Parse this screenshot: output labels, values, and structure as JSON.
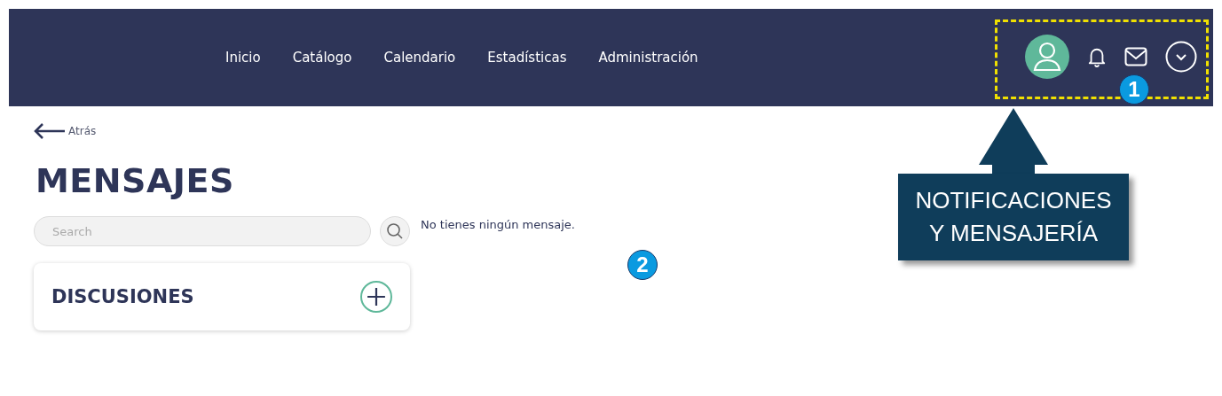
{
  "nav": {
    "links": [
      "Inicio",
      "Catálogo",
      "Calendario",
      "Estadísticas",
      "Administración"
    ]
  },
  "back_link": "Atrás",
  "page_title": "MENSAJES",
  "search": {
    "placeholder": "Search"
  },
  "empty_message": "No tienes ningún mensaje.",
  "discussions": {
    "title": "DISCUSIONES"
  },
  "annotations": {
    "markers": [
      "1",
      "2"
    ],
    "callout": {
      "lines": [
        "NOTIFICACIONES",
        "Y MENSAJERÍA"
      ]
    }
  }
}
